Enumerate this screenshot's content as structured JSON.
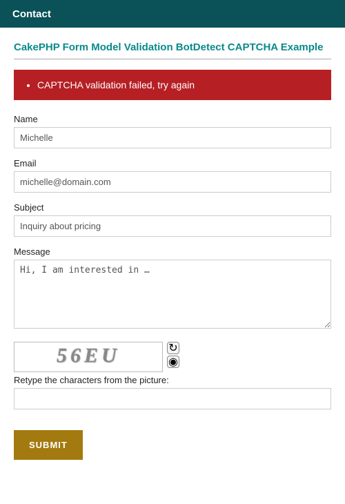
{
  "header": {
    "title": "Contact"
  },
  "page": {
    "title": "CakePHP Form Model Validation BotDetect CAPTCHA Example"
  },
  "error": {
    "messages": [
      "CAPTCHA validation failed, try again"
    ]
  },
  "form": {
    "name": {
      "label": "Name",
      "value": "Michelle"
    },
    "email": {
      "label": "Email",
      "value": "michelle@domain.com"
    },
    "subject": {
      "label": "Subject",
      "value": "Inquiry about pricing"
    },
    "message": {
      "label": "Message",
      "value": "Hi, I am interested in …"
    },
    "captcha": {
      "label": "Retype the characters from the picture:",
      "image_text": "56EU",
      "value": ""
    },
    "submit": {
      "label": "SUBMIT"
    }
  },
  "icons": {
    "reload": "↻",
    "sound": "◉"
  }
}
